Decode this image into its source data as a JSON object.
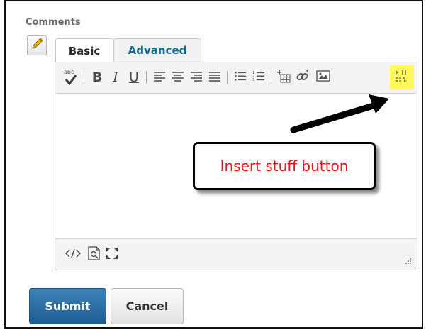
{
  "comments": {
    "label": "Comments"
  },
  "tabs": {
    "basic": "Basic",
    "advanced": "Advanced"
  },
  "toolbar": {
    "spellcheck_abbr": "abc",
    "bold": "B",
    "italic": "I",
    "underline": "U"
  },
  "callout": {
    "text": "Insert stuff button"
  },
  "actions": {
    "submit": "Submit",
    "cancel": "Cancel"
  },
  "colors": {
    "accent_tab": "#0a6e8c",
    "submit_bg": "#2a6ea6",
    "highlight": "#fff95e",
    "callout_text": "#e8151b"
  },
  "icons": [
    "pencil-icon",
    "spellcheck-icon",
    "bold-icon",
    "italic-icon",
    "underline-icon",
    "align-left-icon",
    "align-center-icon",
    "align-right-icon",
    "align-justify-icon",
    "bullet-list-icon",
    "numbered-list-icon",
    "insert-table-icon",
    "insert-link-icon",
    "insert-image-icon",
    "insert-stuff-icon",
    "source-code-icon",
    "preview-icon",
    "fullscreen-icon",
    "resize-grip-icon"
  ]
}
